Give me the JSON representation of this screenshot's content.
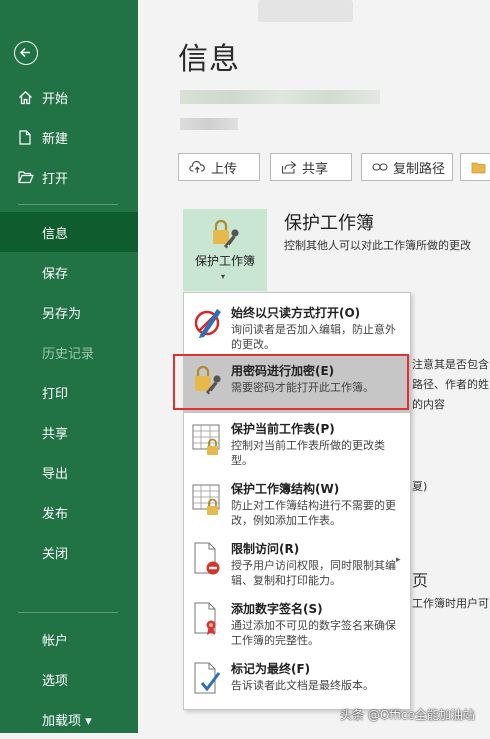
{
  "sidebar": {
    "items": [
      {
        "label": "开始",
        "icon": "home-icon"
      },
      {
        "label": "新建",
        "icon": "new-document-icon"
      },
      {
        "label": "打开",
        "icon": "open-folder-icon"
      },
      {
        "label": "信息",
        "active": true
      },
      {
        "label": "保存"
      },
      {
        "label": "另存为"
      },
      {
        "label": "历史记录",
        "disabled": true
      },
      {
        "label": "打印"
      },
      {
        "label": "共享"
      },
      {
        "label": "导出"
      },
      {
        "label": "发布"
      },
      {
        "label": "关闭"
      },
      {
        "label": "帐户"
      },
      {
        "label": "选项"
      },
      {
        "label": "加载项 ▾"
      }
    ]
  },
  "main": {
    "title": "信息",
    "buttons": {
      "upload": "上传",
      "share": "共享",
      "copy_path": "复制路径"
    },
    "protect": {
      "tile_label": "保护工作簿",
      "caret": "▾",
      "section_title": "保护工作簿",
      "section_desc": "控制其他人可以对此工作簿所做的更改"
    },
    "background_fragments": [
      "注意其是否包含:",
      "路径、作者的姓",
      "的内容",
      "夏)",
      "页",
      "工作簿时用户可以"
    ]
  },
  "dropdown": {
    "items": [
      {
        "title": "始终以只读方式打开(O)",
        "desc": "询问读者是否加入编辑，防止意外的更改。"
      },
      {
        "title": "用密码进行加密(E)",
        "desc": "需要密码才能打开此工作簿。"
      },
      {
        "title": "保护当前工作表(P)",
        "desc": "控制对当前工作表所做的更改类型。"
      },
      {
        "title": "保护工作簿结构(W)",
        "desc": "防止对工作簿结构进行不需要的更改，例如添加工作表。"
      },
      {
        "title": "限制访问(R)",
        "desc": "授予用户访问权限，同时限制其编辑、复制和打印能力。",
        "arrow": "▸"
      },
      {
        "title": "添加数字签名(S)",
        "desc": "通过添加不可见的数字签名来确保工作簿的完整性。"
      },
      {
        "title": "标记为最终(F)",
        "desc": "告诉读者此文档是最终版本。"
      }
    ]
  },
  "watermark": "头条 @Office全能加油站",
  "colors": {
    "sidebar": "#217346",
    "sidebar_active": "#0f5c2e",
    "tile": "#c8e6d2",
    "highlight_box": "#e03030"
  }
}
